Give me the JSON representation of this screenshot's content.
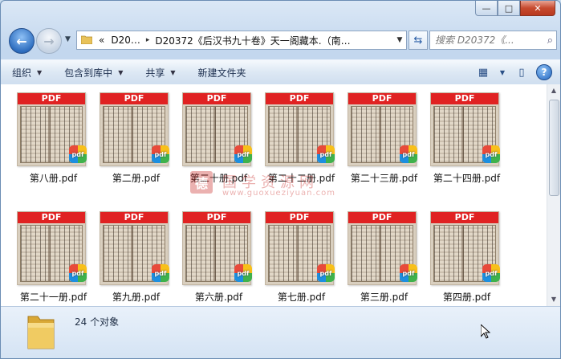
{
  "window": {
    "caption_buttons": {
      "minimize": "—",
      "maximize": "□",
      "close": "✕"
    }
  },
  "nav": {
    "back_icon": "back-arrow-icon",
    "forward_icon": "forward-arrow-icon",
    "address": {
      "overflow": "«",
      "segments": [
        "D20…",
        "D20372《后汉书九十卷》天一阁藏本.（南…"
      ],
      "separator": "▸"
    },
    "search_placeholder": "搜索 D20372《..."
  },
  "toolbar": {
    "organize": "组织",
    "include_in_library": "包含到库中",
    "share": "共享",
    "new_folder": "新建文件夹"
  },
  "files": [
    {
      "name": "第八册.pdf",
      "banner": "PDF"
    },
    {
      "name": "第二册.pdf",
      "banner": "PDF"
    },
    {
      "name": "第二十册.pdf",
      "banner": "PDF"
    },
    {
      "name": "第二十二册.pdf",
      "banner": "PDF"
    },
    {
      "name": "第二十三册.pdf",
      "banner": "PDF"
    },
    {
      "name": "第二十四册.pdf",
      "banner": "PDF"
    },
    {
      "name": "第二十一册.pdf",
      "banner": "PDF"
    },
    {
      "name": "第九册.pdf",
      "banner": "PDF"
    },
    {
      "name": "第六册.pdf",
      "banner": "PDF"
    },
    {
      "name": "第七册.pdf",
      "banner": "PDF"
    },
    {
      "name": "第三册.pdf",
      "banner": "PDF"
    },
    {
      "name": "第四册.pdf",
      "banner": "PDF"
    }
  ],
  "badge_label": "pdf",
  "watermark": {
    "seal": "德",
    "text": "国学资源网",
    "url": "www.guoxueziyuan.com"
  },
  "status": {
    "count_text": "24 个对象"
  }
}
